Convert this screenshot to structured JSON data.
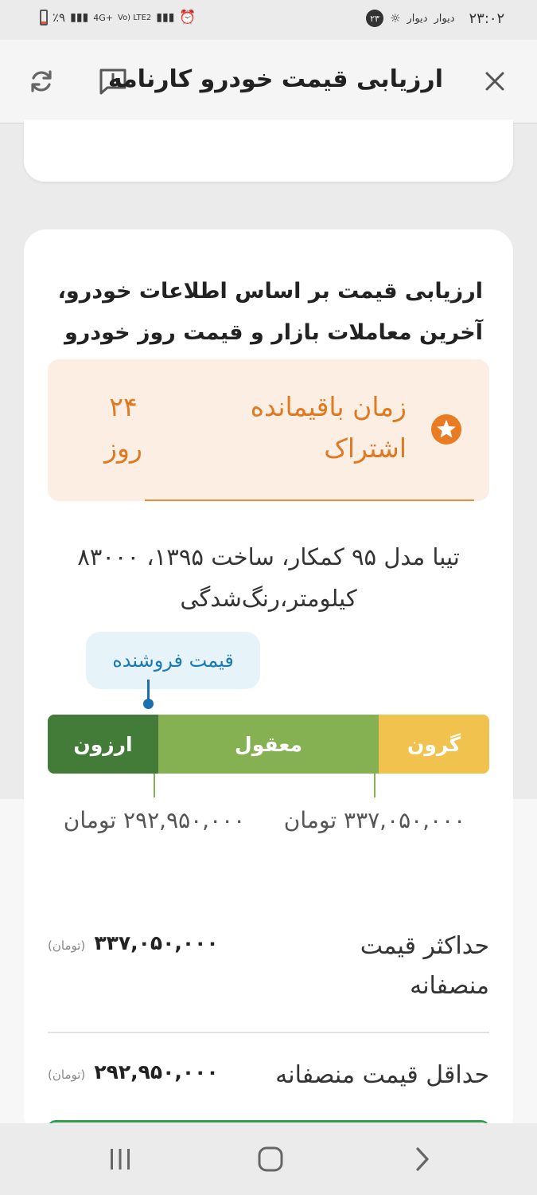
{
  "status_bar": {
    "time": "۲۳:۰۲",
    "notification_1": "دیوار",
    "notification_2": "دیوار",
    "notification_count": "۲۳",
    "battery_text": "٪۹",
    "network_1": "4G+",
    "network_2": "Vo) LTE2"
  },
  "app_bar": {
    "title": "ارزیابی قیمت خودرو کارنامه",
    "close_icon": "close-icon",
    "report_icon": "report-icon",
    "refresh_icon": "refresh-icon"
  },
  "card": {
    "heading": "ارزیابی قیمت بر اساس اطلاعات خودرو، آخرین معاملات بازار و قیمت روز خودرو",
    "subscription": {
      "label": "زمان باقیمانده اشتراک",
      "value": "۲۴ روز",
      "icon": "star-icon"
    },
    "car_description": "تیبا مدل ۹۵ کمکار، ساخت ۱۳۹۵، ۸۳۰۰۰ کیلومتر،رنگ‌شدگی",
    "seller_price_label": "قیمت فروشنده",
    "price_bar": {
      "cheap": "ارزون",
      "fair": "معقول",
      "expensive": "گرون"
    },
    "low_price_label": "۲۹۲,۹۵۰,۰۰۰ تومان",
    "high_price_label": "۳۳۷,۰۵۰,۰۰۰ تومان",
    "max_fair_price": {
      "label": "حداکثر قیمت منصفانه",
      "value": "۳۳۷,۰۵۰,۰۰۰",
      "unit": "(تومان)"
    },
    "min_fair_price": {
      "label": "حداقل قیمت منصفانه",
      "value": "۲۹۲,۹۵۰,۰۰۰",
      "unit": "(تومان)"
    }
  },
  "nav_bar": {
    "recents": "recents-icon",
    "home": "home-icon",
    "back": "back-icon"
  },
  "colors": {
    "orange": "#e07a22",
    "cheap": "#437c38",
    "fair": "#86b153",
    "expensive": "#f1c24e",
    "seller_blue": "#1a7ab8"
  }
}
